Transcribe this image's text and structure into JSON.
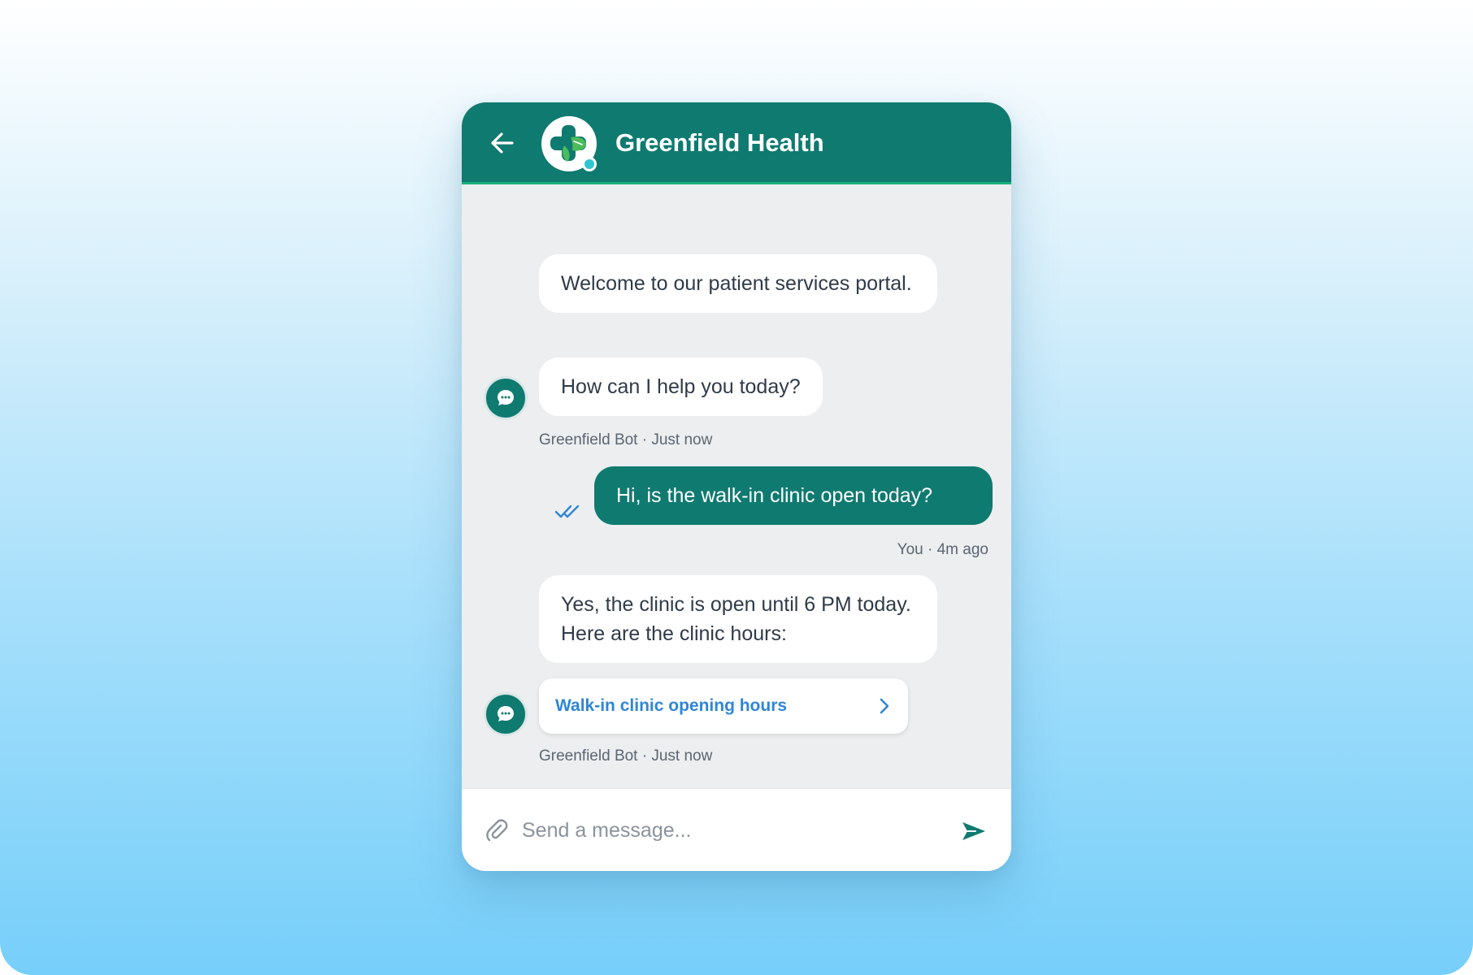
{
  "header": {
    "title": "Greenfield Health",
    "back_icon": "arrow-left-icon",
    "logo_icon": "medical-cross-leaf-icon"
  },
  "messages": {
    "bot_group_1": {
      "bubbles": [
        "Welcome to our patient services portal.",
        "How can I help you today?"
      ],
      "meta": "Greenfield Bot · Just now"
    },
    "user_message": {
      "text": "Hi, is the walk-in clinic open today?",
      "meta": "You · 4m ago",
      "status_icon": "double-check-icon"
    },
    "bot_group_2": {
      "bubbles": [
        "Yes, the clinic is open until 6 PM today. Here are the clinic hours:"
      ],
      "link_label": "Walk-in clinic opening hours",
      "meta": "Greenfield Bot · Just now"
    }
  },
  "composer": {
    "placeholder": "Send a message...",
    "attach_icon": "paperclip-icon",
    "send_icon": "send-icon"
  },
  "colors": {
    "brand": "#0f7a70",
    "accent": "#18b07a",
    "link": "#2f86d6",
    "read_check": "#2f86d6"
  }
}
